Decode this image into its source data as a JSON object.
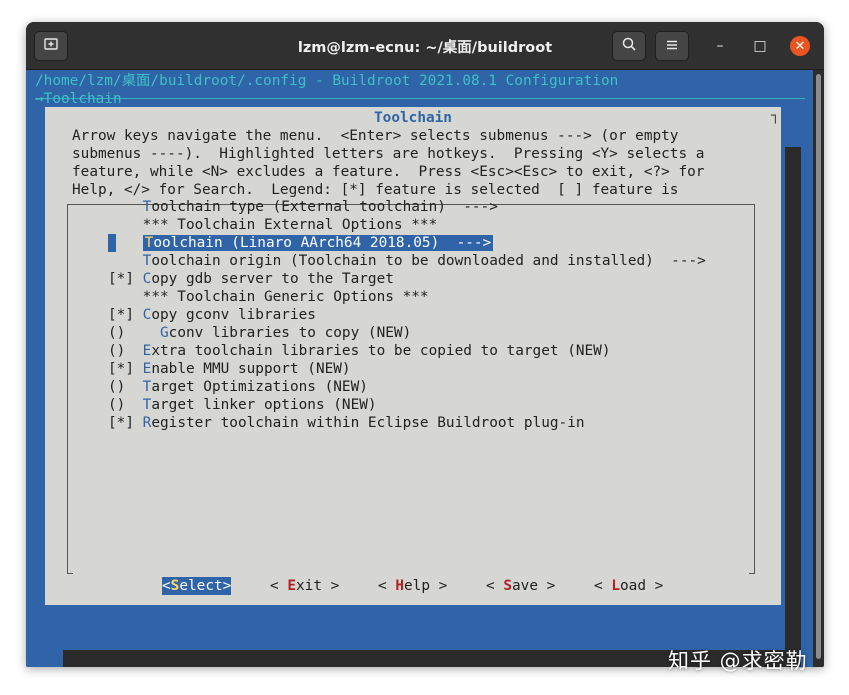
{
  "window": {
    "title": "lzm@lzm-ecnu: ~/桌面/buildroot",
    "new_tab_icon": "⊞",
    "search_icon": "⌕",
    "menu_icon": "☰",
    "minimize_icon": "–",
    "maximize_icon": "□",
    "close_icon": "✕"
  },
  "terminal": {
    "header_line1": "/home/lzm/桌面/buildroot/.config - Buildroot 2021.08.1 Configuration",
    "header_line2": "→Toolchain",
    "dialog_title": "Toolchain",
    "dialog_corner": "┐",
    "help_lines": [
      "Arrow keys navigate the menu.  <Enter> selects submenus ---> (or empty",
      "submenus ----).  Highlighted letters are hotkeys.  Pressing <Y> selects a",
      "feature, while <N> excludes a feature.  Press <Esc><Esc> to exit, <?> for",
      "Help, </> for Search.  Legend: [*] feature is selected  [ ] feature is"
    ],
    "menu_items": [
      {
        "prefix": "    ",
        "hot": "T",
        "rest": "oolchain type (External toolchain)  --->"
      },
      {
        "prefix": "    ",
        "hot": "",
        "rest": "*** Toolchain External Options ***"
      },
      {
        "prefix": "    ",
        "hot": "T",
        "rest": "oolchain (Linaro AArch64 2018.05)  --->",
        "selected": true
      },
      {
        "prefix": "    ",
        "hot": "T",
        "rest": "oolchain origin (Toolchain to be downloaded and installed)  --->"
      },
      {
        "prefix": "[*] ",
        "hot": "C",
        "rest": "opy gdb server to the Target"
      },
      {
        "prefix": "    ",
        "hot": "",
        "rest": "*** Toolchain Generic Options ***"
      },
      {
        "prefix": "[*] ",
        "hot": "C",
        "rest": "opy gconv libraries"
      },
      {
        "prefix": "()    ",
        "hot": "G",
        "rest": "conv libraries to copy (NEW)"
      },
      {
        "prefix": "()  ",
        "hot": "E",
        "rest": "xtra toolchain libraries to be copied to target (NEW)"
      },
      {
        "prefix": "[*] ",
        "hot": "E",
        "rest": "nable MMU support (NEW)"
      },
      {
        "prefix": "()  ",
        "hot": "T",
        "rest": "arget Optimizations (NEW)"
      },
      {
        "prefix": "()  ",
        "hot": "T",
        "rest": "arget linker options (NEW)"
      },
      {
        "prefix": "[*] ",
        "hot": "R",
        "rest": "egister toolchain within Eclipse Buildroot plug-in"
      }
    ],
    "buttons": [
      {
        "open": "<",
        "hot": "S",
        "rest": "elect",
        "close": ">",
        "selected": true
      },
      {
        "open": "< ",
        "hot": "E",
        "rest": "xit",
        "close": " >"
      },
      {
        "open": "< ",
        "hot": "H",
        "rest": "elp",
        "close": " >"
      },
      {
        "open": "< ",
        "hot": "S",
        "rest": "ave",
        "close": " >"
      },
      {
        "open": "< ",
        "hot": "L",
        "rest": "oad",
        "close": " >"
      }
    ]
  },
  "watermark": "知乎 @求密勒",
  "colors": {
    "terminal_bg": "#2f64a8",
    "dialog_bg": "#d6d6d2",
    "header_text": "#3ec1c4",
    "hotkey_blue": "#2f64a8",
    "button_hotkey": "#b22222",
    "close_button": "#e95420"
  }
}
